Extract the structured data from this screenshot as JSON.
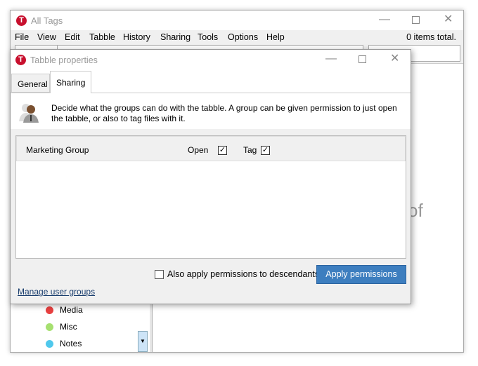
{
  "main_window": {
    "title": "All Tags",
    "status": "0 items total.",
    "menu": [
      "File",
      "View",
      "Edit",
      "Tabble",
      "History",
      "Sharing",
      "Tools",
      "Options",
      "Help"
    ],
    "tags": [
      {
        "label": "Media",
        "color": "#e84040"
      },
      {
        "label": "Misc",
        "color": "#a6e070"
      },
      {
        "label": "Notes",
        "color": "#50c8ec"
      }
    ],
    "main_text_fragment": "of"
  },
  "dialog": {
    "title": "Tabble properties",
    "tabs": [
      "General",
      "Sharing"
    ],
    "active_tab": "Sharing",
    "description": "Decide what the groups can do with the tabble. A group can be given permission to just open the tabble, or also to tag files with it.",
    "groups": [
      {
        "name": "Marketing Group",
        "open_label": "Open",
        "open": true,
        "tag_label": "Tag",
        "tag": true
      }
    ],
    "descendants_label": "Also apply permissions to descendants",
    "descendants": false,
    "apply_label": "Apply permissions",
    "manage_link": "Manage user groups",
    "accent": "#3d7ebf"
  }
}
